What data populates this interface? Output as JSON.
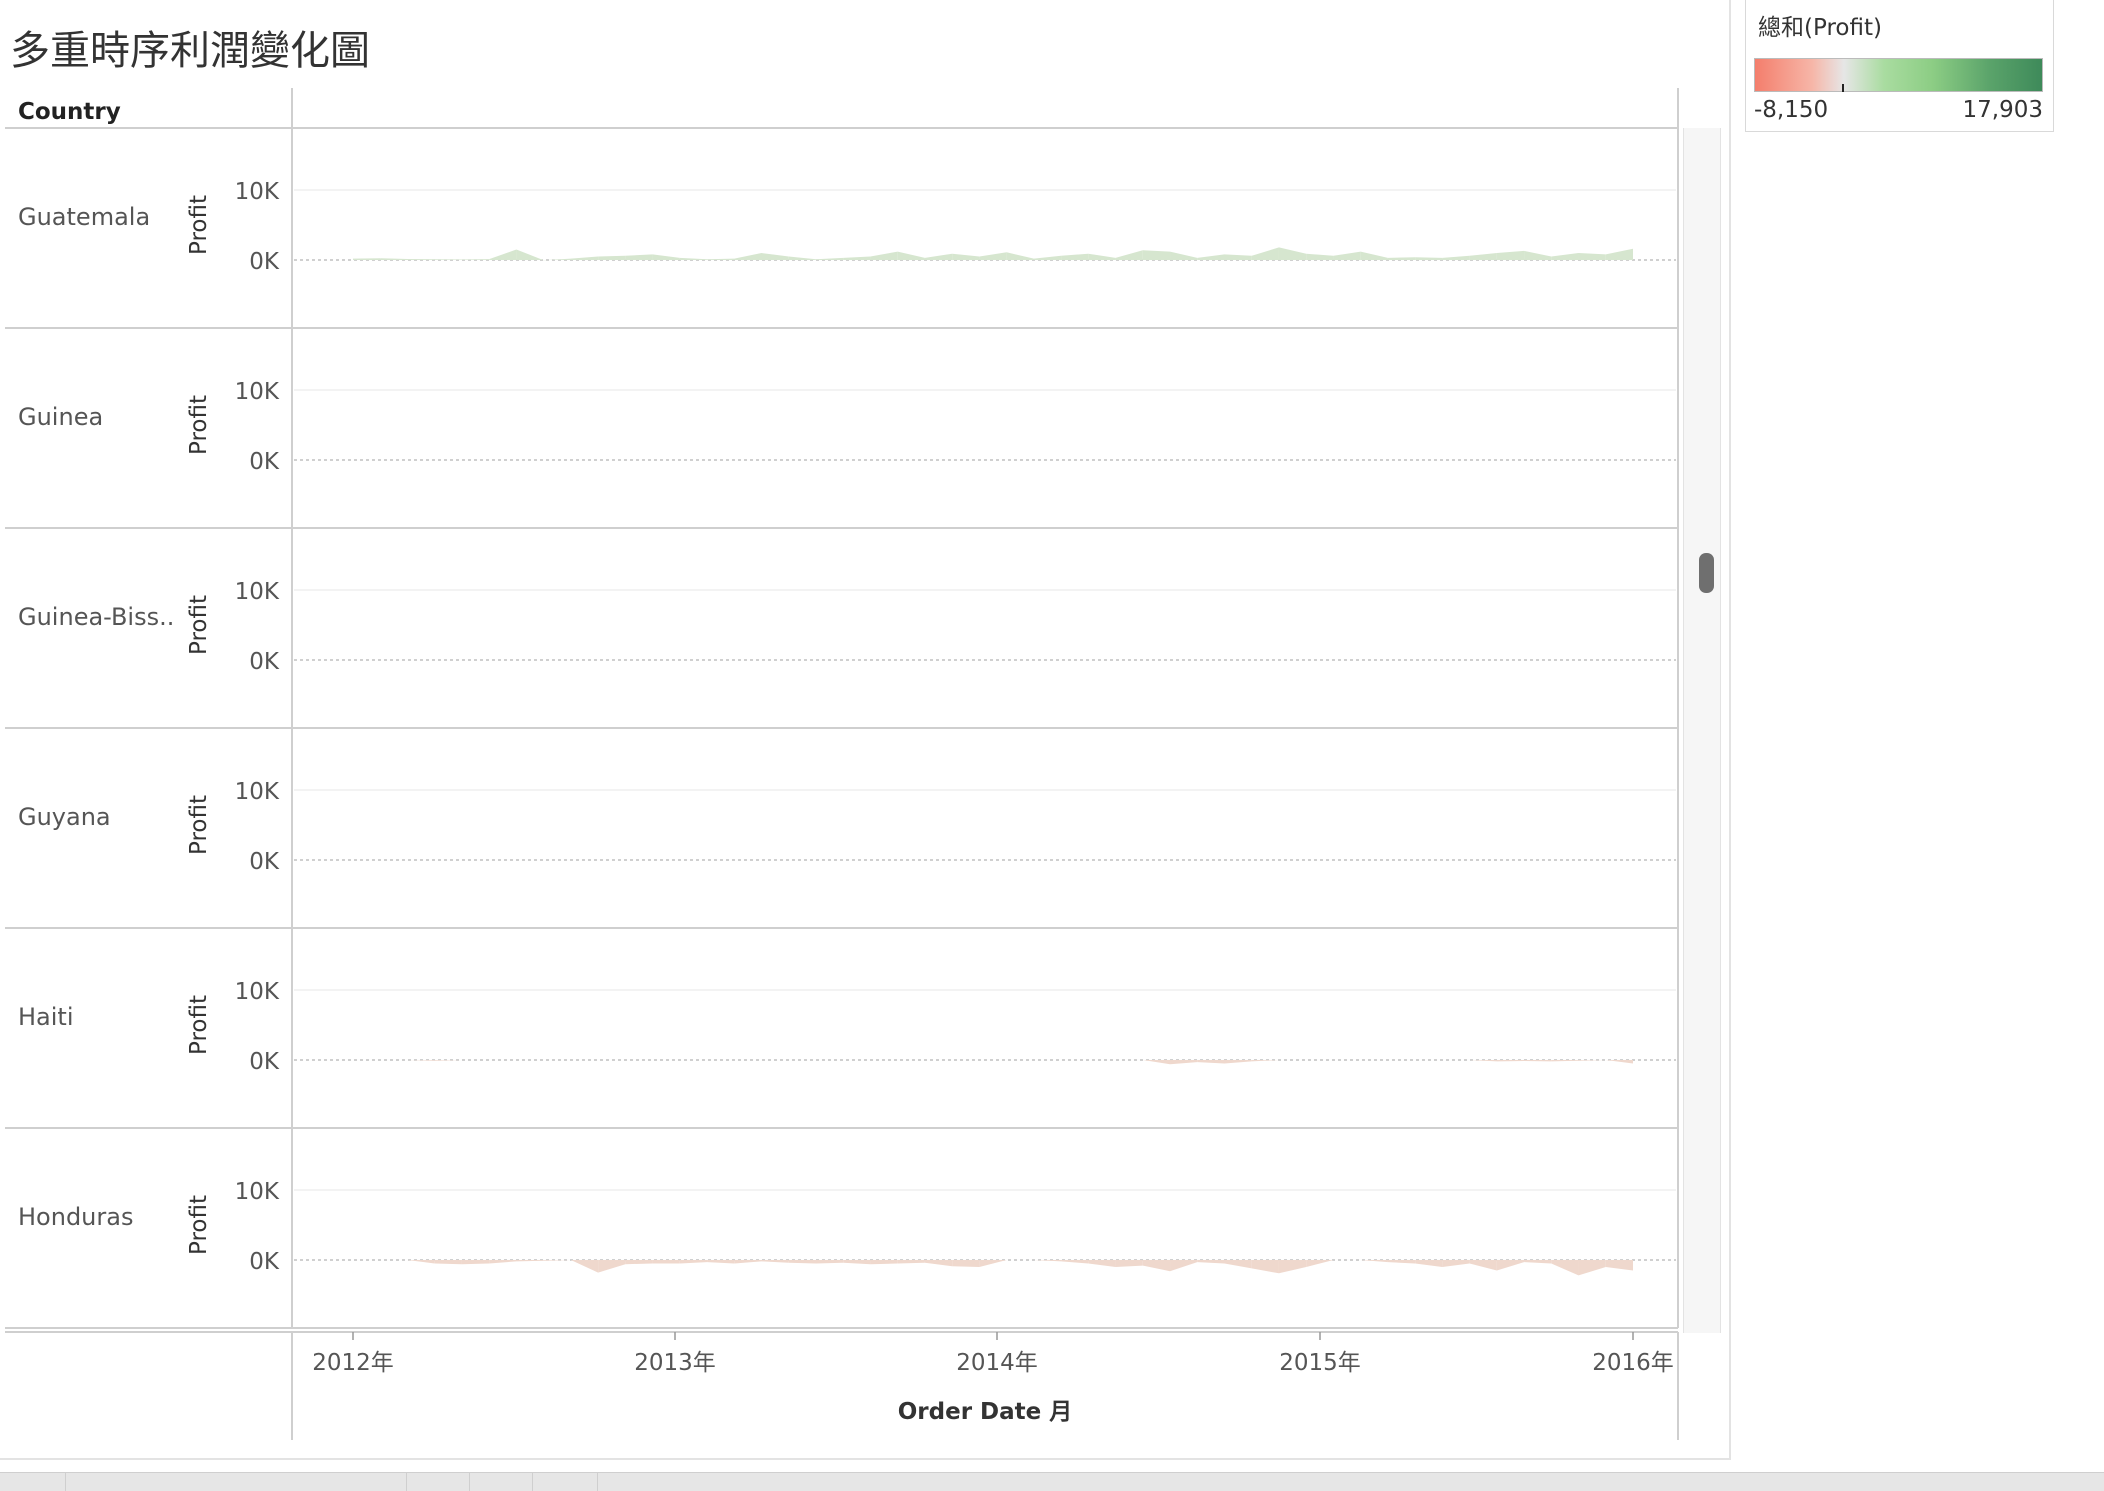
{
  "title": "多重時序利潤變化圖",
  "legend": {
    "title": "總和(Profit)",
    "min_label": "-8,150",
    "max_label": "17,903",
    "colors": {
      "negative": "#f47e6c",
      "neutral": "#e6e6e6",
      "positive": "#3e8a5a"
    }
  },
  "colors": {
    "pos_fill": "#d6e6cf",
    "neg_fill": "#efd8cd"
  },
  "chart_data": {
    "type": "area",
    "row_header": "Country",
    "ylabel": "Profit",
    "xlabel": "Order Date 月",
    "y_ticks": [
      "10K",
      "0K"
    ],
    "ylim": [
      -8150,
      17903
    ],
    "x_ticks": [
      "2012年",
      "2013年",
      "2014年",
      "2015年",
      "2016年"
    ],
    "x": [
      "2012-01",
      "2012-02",
      "2012-03",
      "2012-04",
      "2012-05",
      "2012-06",
      "2012-07",
      "2012-08",
      "2012-09",
      "2012-10",
      "2012-11",
      "2012-12",
      "2013-01",
      "2013-02",
      "2013-03",
      "2013-04",
      "2013-05",
      "2013-06",
      "2013-07",
      "2013-08",
      "2013-09",
      "2013-10",
      "2013-11",
      "2013-12",
      "2014-01",
      "2014-02",
      "2014-03",
      "2014-04",
      "2014-05",
      "2014-06",
      "2014-07",
      "2014-08",
      "2014-09",
      "2014-10",
      "2014-11",
      "2014-12",
      "2015-01",
      "2015-02",
      "2015-03",
      "2015-04",
      "2015-05",
      "2015-06",
      "2015-07",
      "2015-08",
      "2015-09",
      "2015-10",
      "2015-11",
      "2015-12"
    ],
    "series": [
      {
        "name": "Guatemala",
        "values": [
          200,
          250,
          150,
          100,
          80,
          120,
          1500,
          -30,
          200,
          500,
          600,
          800,
          300,
          100,
          200,
          1000,
          500,
          100,
          300,
          500,
          1200,
          300,
          900,
          500,
          1100,
          200,
          600,
          900,
          300,
          1400,
          1200,
          300,
          800,
          600,
          1800,
          900,
          600,
          1200,
          300,
          400,
          300,
          600,
          1000,
          1300,
          500,
          1000,
          800,
          1600
        ]
      },
      {
        "name": "Guinea",
        "values": [
          0,
          0,
          0,
          0,
          0,
          0,
          0,
          0,
          0,
          0,
          0,
          0,
          0,
          0,
          0,
          0,
          0,
          0,
          0,
          0,
          0,
          0,
          0,
          0,
          0,
          0,
          0,
          0,
          0,
          0,
          0,
          0,
          0,
          0,
          0,
          0,
          0,
          0,
          0,
          0,
          0,
          0,
          0,
          0,
          0,
          0,
          0,
          0
        ]
      },
      {
        "name": "Guinea-Bissau",
        "values": [
          0,
          0,
          0,
          0,
          0,
          0,
          0,
          0,
          0,
          0,
          0,
          0,
          0,
          0,
          0,
          0,
          0,
          0,
          0,
          0,
          0,
          0,
          0,
          0,
          0,
          0,
          0,
          0,
          0,
          0,
          0,
          0,
          0,
          0,
          0,
          0,
          0,
          0,
          0,
          0,
          0,
          0,
          0,
          0,
          0,
          0,
          0,
          0
        ]
      },
      {
        "name": "Guyana",
        "values": [
          0,
          0,
          0,
          0,
          0,
          0,
          0,
          0,
          0,
          0,
          0,
          0,
          0,
          0,
          0,
          0,
          0,
          0,
          0,
          0,
          0,
          0,
          0,
          0,
          0,
          0,
          0,
          0,
          0,
          0,
          0,
          0,
          0,
          0,
          0,
          0,
          0,
          0,
          0,
          0,
          0,
          0,
          0,
          0,
          0,
          0,
          0,
          0
        ]
      },
      {
        "name": "Haiti",
        "values": [
          0,
          0,
          0,
          -100,
          0,
          0,
          0,
          0,
          0,
          0,
          0,
          0,
          0,
          0,
          0,
          0,
          0,
          0,
          0,
          0,
          0,
          0,
          0,
          0,
          0,
          0,
          0,
          0,
          0,
          0,
          -600,
          -300,
          -500,
          -200,
          0,
          0,
          0,
          0,
          0,
          0,
          0,
          0,
          -200,
          -150,
          -200,
          -100,
          0,
          -500
        ]
      },
      {
        "name": "Honduras",
        "values": [
          0,
          0,
          0,
          -500,
          -600,
          -500,
          -200,
          -100,
          0,
          -1800,
          -600,
          -500,
          -500,
          -300,
          -500,
          -200,
          -400,
          -500,
          -400,
          -600,
          -500,
          -400,
          -900,
          -1000,
          0,
          0,
          -200,
          -500,
          -1000,
          -800,
          -1600,
          -300,
          -500,
          -1200,
          -1900,
          -1000,
          0,
          0,
          -300,
          -500,
          -1000,
          -500,
          -1500,
          -300,
          -500,
          -2200,
          -1000,
          -1500
        ]
      }
    ],
    "row_labels": [
      "Guatemala",
      "Guinea",
      "Guinea-Biss..",
      "Guyana",
      "Haiti",
      "Honduras"
    ]
  }
}
